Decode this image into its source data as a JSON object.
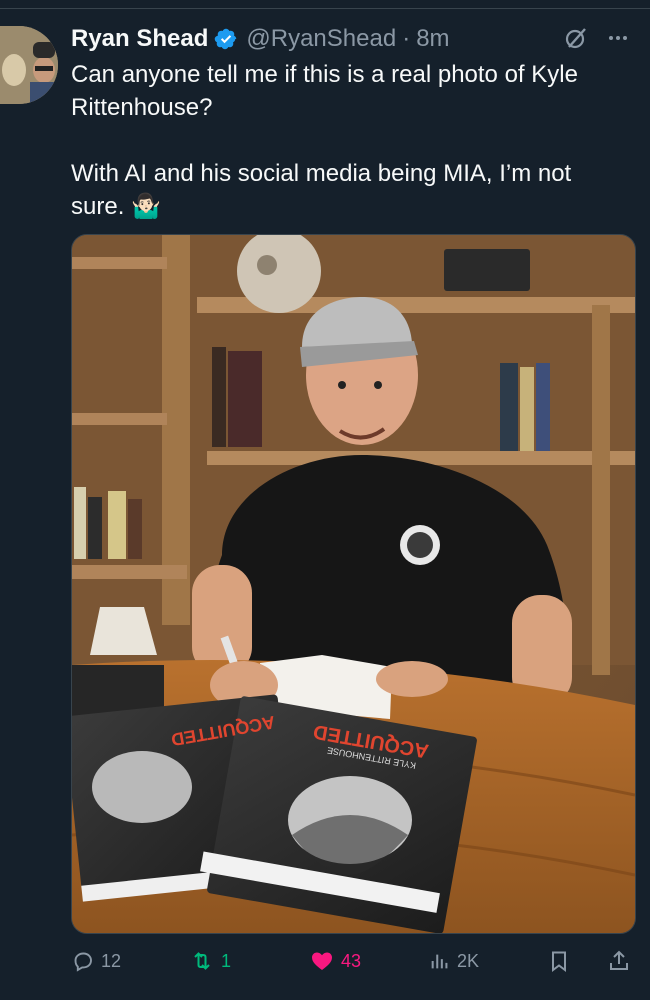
{
  "tweet": {
    "author_name": "Ryan Shead",
    "handle": "@RyanShead",
    "separator": "·",
    "time": "8m",
    "text": "Can anyone tell me if this is a real photo of Kyle Rittenhouse?\n\nWith AI and his social media being MIA, I’m not sure. 🤷🏻‍♂️"
  },
  "icons": {
    "verified": "verified-badge-icon",
    "grok": "grok-icon",
    "more": "more-icon",
    "reply": "reply-icon",
    "retweet": "retweet-icon",
    "like": "heart-icon",
    "views": "views-icon",
    "bookmark": "bookmark-icon",
    "share": "share-icon"
  },
  "photo": {
    "book_title": "ACQUITTED",
    "book_author": "KYLE RITTENHOUSE"
  },
  "actions": {
    "replies": "12",
    "retweets": "1",
    "likes": "43",
    "views": "2K"
  },
  "colors": {
    "background": "#15202b",
    "secondary_text": "#8b98a5",
    "verified": "#1d9bf0",
    "like": "#f91880",
    "retweet": "#00ba7c"
  }
}
